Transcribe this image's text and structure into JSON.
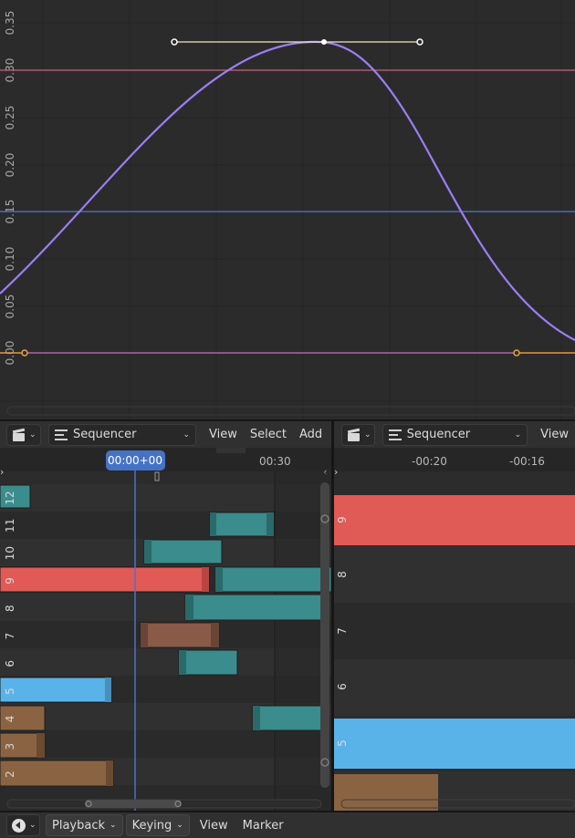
{
  "graph_editor": {
    "y_ticks": [
      "0.35",
      "0.30",
      "0.25",
      "0.20",
      "0.15",
      "0.10",
      "0.05",
      "0.00"
    ],
    "colors": {
      "curve": "#9c7ef5",
      "pink_line": "#d65b7d",
      "blue_line": "#4f79c9",
      "zero_line": "#c86fc0",
      "handle": "#e8a441"
    }
  },
  "sequencer_left": {
    "editor_icon": "clapperboard-icon",
    "view_mode": "Sequencer",
    "menus": [
      "View",
      "Select",
      "Add"
    ],
    "playhead_time": "00:00+00",
    "time_labels": [
      "00:30"
    ],
    "channels": [
      "12",
      "11",
      "10",
      "9",
      "8",
      "7",
      "6",
      "5",
      "4",
      "3",
      "2"
    ],
    "colors": {
      "selected": "#e05a56",
      "teal": "#3b8c8c",
      "blue": "#5ab3e8",
      "brown": "#8a6442",
      "playhead": "#5070c8"
    }
  },
  "sequencer_right": {
    "editor_icon": "clapperboard-icon",
    "view_mode": "Sequencer",
    "menus": [
      "View"
    ],
    "time_labels": [
      "-00:20",
      "-00:16"
    ],
    "channels": [
      "9",
      "8",
      "7",
      "6",
      "5"
    ]
  },
  "timeline_bar": {
    "editor_icon": "clock-icon",
    "menus": [
      "Playback",
      "Keying",
      "View",
      "Marker"
    ]
  }
}
